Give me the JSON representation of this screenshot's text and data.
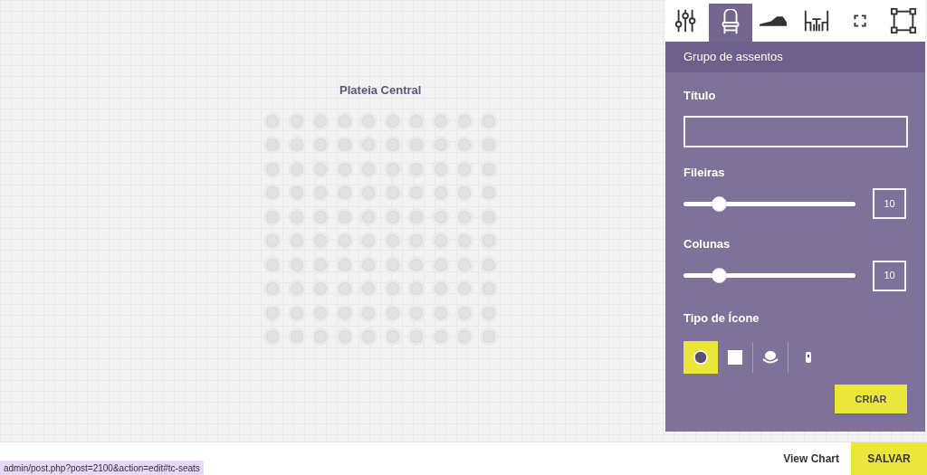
{
  "seat_map": {
    "title": "Plateia Central"
  },
  "tool_tabs": [
    {
      "kind": "sliders",
      "selected": false
    },
    {
      "kind": "chair",
      "selected": true
    },
    {
      "kind": "shoe",
      "selected": false
    },
    {
      "kind": "table",
      "selected": false
    },
    {
      "kind": "corners",
      "selected": false
    },
    {
      "kind": "frame",
      "selected": false
    }
  ],
  "panel": {
    "title": "Grupo de assentos",
    "title_label": "Título",
    "rows": {
      "label": "Fileiras",
      "level": 0.18,
      "value": "10"
    },
    "columns": {
      "label": "Colunas",
      "level": 0.18,
      "value": "10"
    },
    "icon_type_label": "Tipo de Ícone",
    "icon_types": [
      {
        "kind": "circle",
        "selected": true
      },
      {
        "kind": "square",
        "selected": false
      },
      {
        "kind": "dome",
        "selected": false
      },
      {
        "kind": "bottle",
        "selected": false
      }
    ],
    "create_button": "CRIAR"
  },
  "bottom_bar": {
    "view_chart": "View Chart",
    "save": "SALVAR"
  },
  "status_url": "admin/post.php?post=2100&action=edit#tc-seats"
}
